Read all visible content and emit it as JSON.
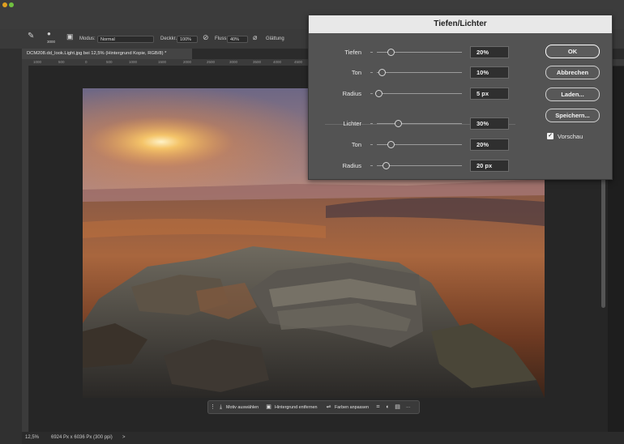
{
  "options_bar": {
    "size_value": "3000",
    "mode_label": "Modus:",
    "mode_value": "Normal",
    "opacity_label": "Deckkr.:",
    "opacity_value": "100%",
    "flow_label": "Fluss:",
    "flow_value": "40%",
    "smoothing_label": "Glättung"
  },
  "document_tab": {
    "title": "DCM208.dd_look.Light.jpg bei 12,5% (Hintergrund Kopie, RGB/8) *"
  },
  "ruler": {
    "ticks": [
      "1000",
      "500",
      "0",
      "500",
      "1000",
      "1500",
      "2000",
      "2500",
      "3000",
      "3500",
      "4000",
      "4500"
    ]
  },
  "status_bar": {
    "zoom": "12,5%",
    "dimensions": "6924 Px x 6036 Px (300 ppi)",
    "arrow": ">"
  },
  "contextual_taskbar": {
    "select_subject": "Motiv auswählen",
    "remove_background": "Hintergrund entfernen",
    "adjust_colors": "Farben anpassen",
    "more": "···"
  },
  "dialog": {
    "title": "Tiefen/Lichter",
    "shadows": [
      {
        "label": "Tiefen",
        "value": "20%",
        "position": 0.2
      },
      {
        "label": "Ton",
        "value": "10%",
        "position": 0.1
      },
      {
        "label": "Radius",
        "value": "5 px",
        "position": 0.05
      }
    ],
    "highlights": [
      {
        "label": "Lichter",
        "value": "30%",
        "position": 0.3
      },
      {
        "label": "Ton",
        "value": "20%",
        "position": 0.2
      },
      {
        "label": "Radius",
        "value": "20 px",
        "position": 0.15
      }
    ],
    "buttons": {
      "ok": "OK",
      "cancel": "Abbrechen",
      "load": "Laden...",
      "save": "Speichern..."
    },
    "preview_label": "Vorschau",
    "preview_checked": true
  }
}
